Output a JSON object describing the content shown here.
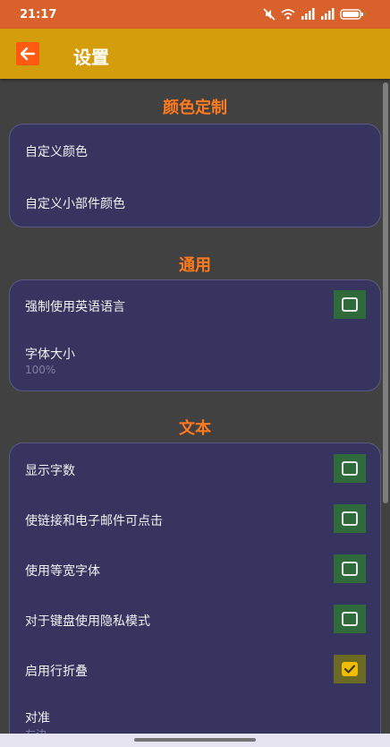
{
  "status_bar": {
    "time": "21:17",
    "icons": [
      "mute-icon",
      "wifi-icon",
      "signal-icon",
      "signal-icon",
      "battery-icon"
    ]
  },
  "app_bar": {
    "back_icon": "arrow-left-icon",
    "title": "设置",
    "colors": {
      "status": "#d8612c",
      "bar": "#d49d0c",
      "back": "#ff5a10"
    }
  },
  "sections": [
    {
      "title": "颜色定制",
      "items": [
        {
          "label": "自定义颜色"
        },
        {
          "label": "自定义小部件颜色"
        }
      ]
    },
    {
      "title": "通用",
      "items": [
        {
          "label": "强制使用英语语言",
          "checked": false
        },
        {
          "label": "字体大小",
          "value": "100%"
        }
      ]
    },
    {
      "title": "文本",
      "items": [
        {
          "label": "显示字数",
          "checked": false
        },
        {
          "label": "使链接和电子邮件可点击",
          "checked": false
        },
        {
          "label": "使用等宽字体",
          "checked": false
        },
        {
          "label": "对于键盘使用隐私模式",
          "checked": false
        },
        {
          "label": "启用行折叠",
          "checked": true
        },
        {
          "label": "对准",
          "value": "左边"
        }
      ]
    }
  ],
  "theme": {
    "background": "#414141",
    "card": "#37345f",
    "accent": "#ff7a1f",
    "checkbox_bg": "#2f6a3b",
    "checkbox_checked": "#f2bc00"
  }
}
